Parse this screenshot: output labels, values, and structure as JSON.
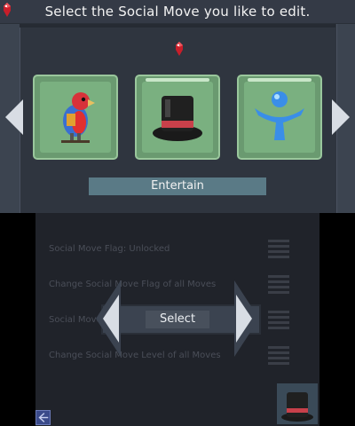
{
  "header": {
    "title": "Select the Social Move you like to edit."
  },
  "moves": {
    "cards": [
      {
        "icon": "parrot-icon"
      },
      {
        "icon": "top-hat-icon"
      },
      {
        "icon": "blue-figure-icon"
      }
    ],
    "selected_label": "Entertain"
  },
  "settings_menu": {
    "items": [
      "Social Move Flag: Unlocked",
      "Change Social Move Flag of all Moves",
      "Social Move",
      "Change Social Move Level of all Moves"
    ],
    "select_label": "Select"
  },
  "colors": {
    "card_fill": "#7ab080",
    "card_border": "#9ac79c",
    "label_bg": "#5a7a86",
    "arrow": "#d8dde4"
  }
}
